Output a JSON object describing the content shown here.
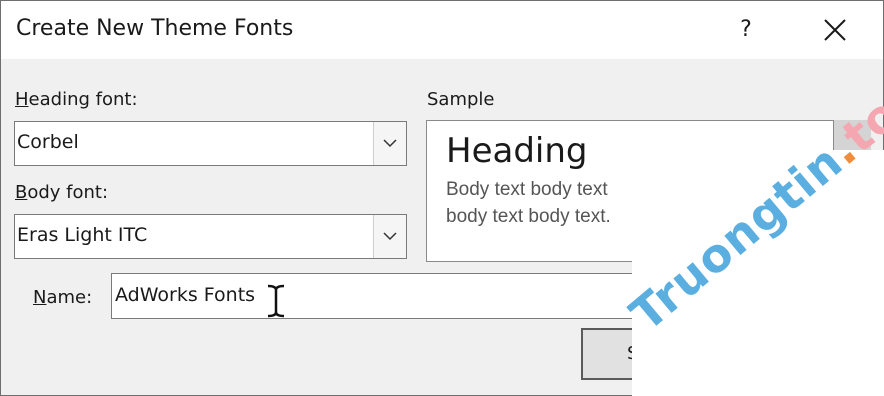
{
  "dialog": {
    "title": "Create New Theme Fonts",
    "help_label": "?"
  },
  "heading_font": {
    "label_accel": "H",
    "label_rest": "eading font:",
    "value": "Corbel"
  },
  "body_font": {
    "label_accel": "B",
    "label_rest": "ody font:",
    "value": "Eras Light ITC"
  },
  "sample": {
    "label": "Sample",
    "heading": "Heading",
    "body": "Body text body text body text body text."
  },
  "name": {
    "label_accel": "N",
    "label_rest": "ame:",
    "value": "AdWorks Fonts"
  },
  "save_button": {
    "label": "S"
  },
  "watermark": {
    "main": "Truongtin",
    "dot": ".",
    "tail": "top"
  }
}
